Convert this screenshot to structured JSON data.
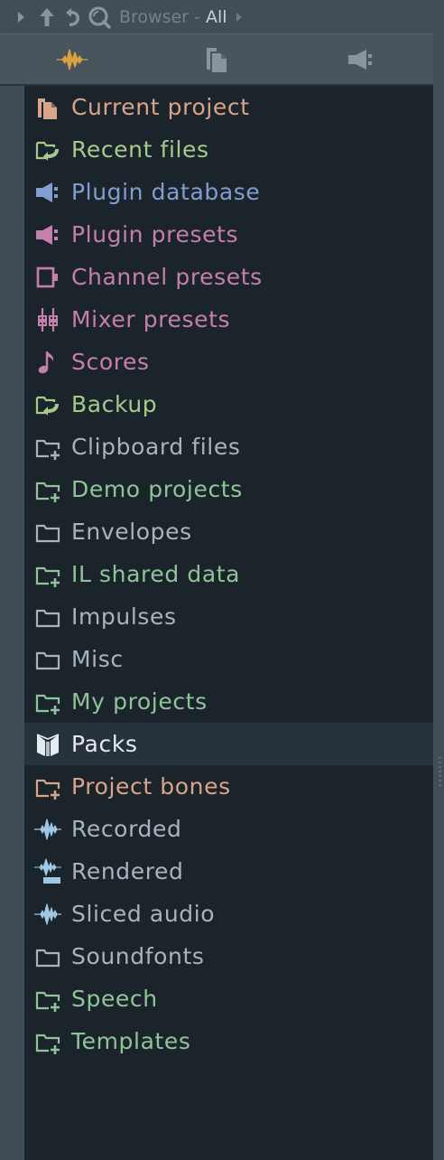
{
  "header": {
    "title": "Browser",
    "separator": "-",
    "filter": "All"
  },
  "tabs": [
    {
      "icon": "waveform-icon"
    },
    {
      "icon": "documents-icon"
    },
    {
      "icon": "plugin-speaker-icon"
    }
  ],
  "items": [
    {
      "label": "Current project",
      "icon": "project-file-icon",
      "color": "#d8a48a"
    },
    {
      "label": "Recent files",
      "icon": "folder-recent-icon",
      "color": "#a6c98c"
    },
    {
      "label": "Plugin database",
      "icon": "plugin-speaker-icon",
      "color": "#7f9fd0"
    },
    {
      "label": "Plugin presets",
      "icon": "plugin-speaker-icon",
      "color": "#c57fab"
    },
    {
      "label": "Channel presets",
      "icon": "channel-icon",
      "color": "#c57fab"
    },
    {
      "label": "Mixer presets",
      "icon": "mixer-icon",
      "color": "#c57fab"
    },
    {
      "label": "Scores",
      "icon": "note-icon",
      "color": "#c57fab"
    },
    {
      "label": "Backup",
      "icon": "folder-recent-icon",
      "color": "#a6c98c"
    },
    {
      "label": "Clipboard files",
      "icon": "folder-plus-icon",
      "color": "#a8b4bd"
    },
    {
      "label": "Demo projects",
      "icon": "folder-plus-icon",
      "color": "#8fc49a"
    },
    {
      "label": "Envelopes",
      "icon": "folder-icon",
      "color": "#a8b4bd"
    },
    {
      "label": "IL shared data",
      "icon": "folder-plus-icon",
      "color": "#8fc49a"
    },
    {
      "label": "Impulses",
      "icon": "folder-icon",
      "color": "#a8b4bd"
    },
    {
      "label": "Misc",
      "icon": "folder-icon",
      "color": "#a8b4bd"
    },
    {
      "label": "My projects",
      "icon": "folder-plus-icon",
      "color": "#8fc49a"
    },
    {
      "label": "Packs",
      "icon": "pack-box-icon",
      "color": "#e4ecf3",
      "selected": true
    },
    {
      "label": "Project bones",
      "icon": "folder-plus-icon",
      "color": "#d8a48a"
    },
    {
      "label": "Recorded",
      "icon": "waveform-icon",
      "color": "#a8b4bd"
    },
    {
      "label": "Rendered",
      "icon": "waveform-render-icon",
      "color": "#a8b4bd"
    },
    {
      "label": "Sliced audio",
      "icon": "waveform-icon",
      "color": "#a8b4bd"
    },
    {
      "label": "Soundfonts",
      "icon": "folder-icon",
      "color": "#a8b4bd"
    },
    {
      "label": "Speech",
      "icon": "folder-plus-icon",
      "color": "#8fc49a"
    },
    {
      "label": "Templates",
      "icon": "folder-plus-icon",
      "color": "#8fc49a"
    }
  ],
  "colors": {
    "background": "#1c242b",
    "header": "#434d56",
    "tab_active_icon": "#d9a23e",
    "icon_muted": "#8a949c",
    "waveform_icon": "#9ec7e6",
    "pack_icon": "#e4ecf3"
  }
}
